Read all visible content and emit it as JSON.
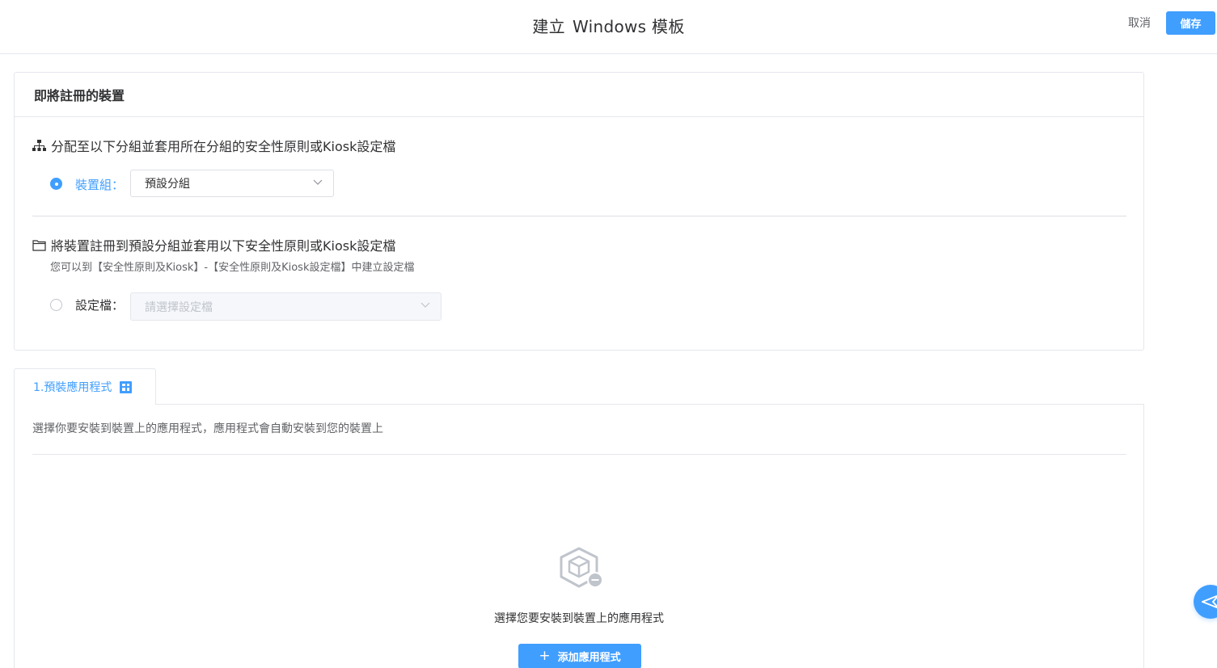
{
  "header": {
    "title_prefix": "建立",
    "title_rest": "Windows 模板",
    "cancel_label": "取消",
    "save_label": "儲存"
  },
  "enroll_card": {
    "title": "即將註冊的裝置",
    "option1": {
      "title": "分配至以下分組並套用所在分組的安全性原則或Kiosk設定檔",
      "field_label": "裝置組：",
      "select_value": "預設分組",
      "checked": true,
      "icon": "hierarchy-icon"
    },
    "option2": {
      "title": "將裝置註冊到預設分組並套用以下安全性原則或Kiosk設定檔",
      "hint": "您可以到【安全性原則及Kiosk】-【安全性原則及Kiosk設定檔】中建立設定檔",
      "field_label": "設定檔：",
      "select_placeholder": "請選擇設定檔",
      "checked": false,
      "icon": "folder-icon"
    }
  },
  "apps_tab": {
    "label": "1.預裝應用程式",
    "icon": "windows-icon",
    "description": "選擇你要安裝到裝置上的應用程式，應用程式會自動安裝到您的裝置上",
    "empty_text": "選擇您要安裝到裝置上的應用程式",
    "add_button_label": "添加應用程式"
  },
  "colors": {
    "primary": "#409eff",
    "border": "#e4e7ed",
    "text": "#303133",
    "muted": "#606266"
  }
}
